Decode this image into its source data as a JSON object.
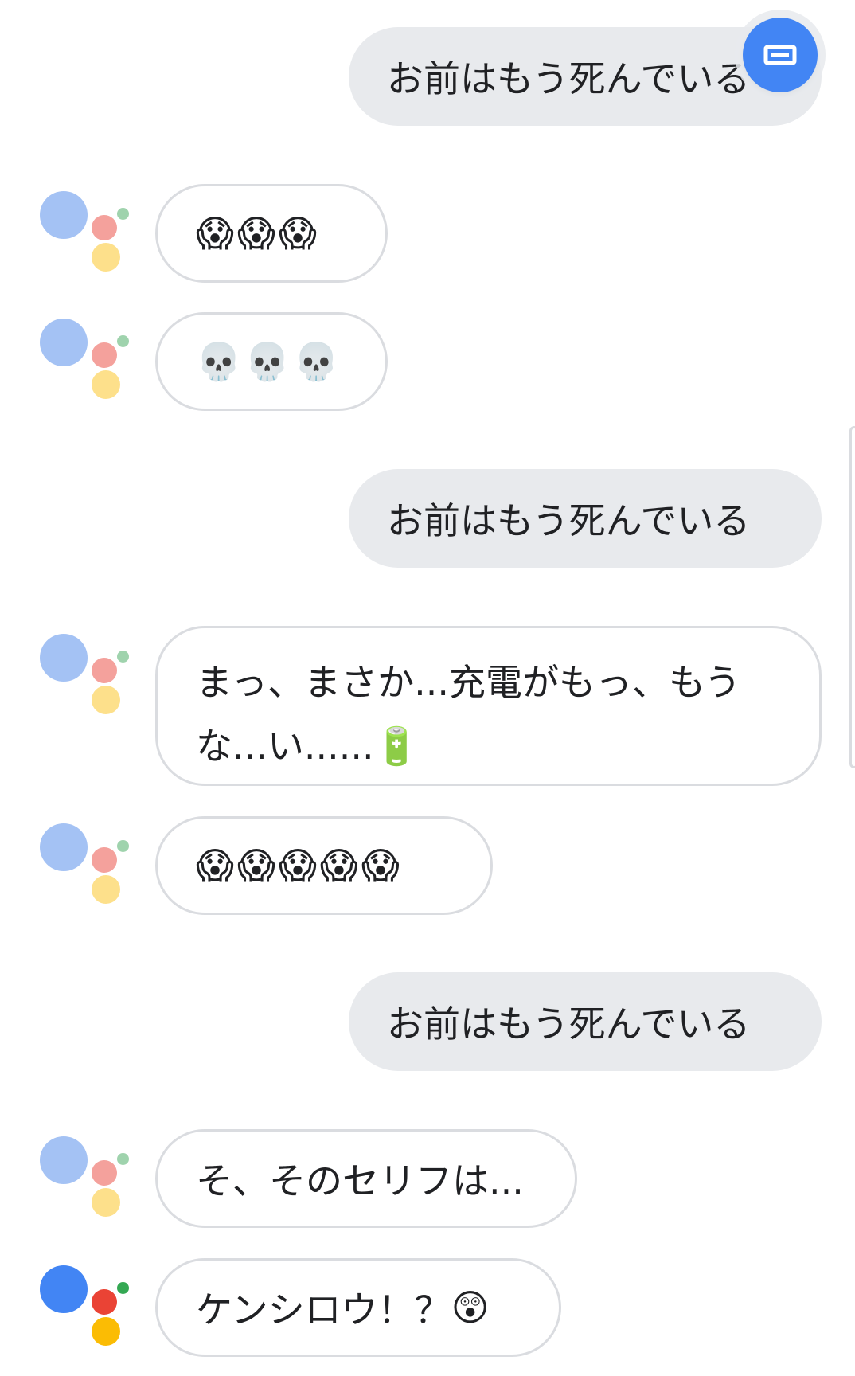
{
  "conversation": [
    {
      "role": "user",
      "text": "お前はもう死んでいる"
    },
    {
      "role": "assistant",
      "emojis": [
        "😱",
        "😱",
        "😱"
      ]
    },
    {
      "role": "assistant",
      "emojis": [
        "💀",
        "💀",
        "💀"
      ]
    },
    {
      "role": "user",
      "text": "お前はもう死んでいる"
    },
    {
      "role": "assistant",
      "line1": "まっ、まさか...充電がもっ、もう",
      "line2": "な...い......",
      "emoji": "🔋"
    },
    {
      "role": "assistant",
      "emojis": [
        "😱",
        "😱",
        "😱",
        "😱",
        "😱"
      ]
    },
    {
      "role": "user",
      "text": "お前はもう死んでいる"
    },
    {
      "role": "assistant",
      "text": "そ、そのセリフは..."
    },
    {
      "role": "assistant",
      "text": "ケンシロウ！？",
      "emoji": "😲"
    }
  ],
  "keyboard_button": {
    "icon": "keyboard-icon"
  },
  "colors": {
    "assistant_blue_faded": "#a4c2f4",
    "assistant_red_faded": "#f4a19c",
    "assistant_yellow_faded": "#fde08b",
    "assistant_green_faded": "#9fd3ad",
    "assistant_blue": "#4285f4",
    "assistant_red": "#ea4335",
    "assistant_yellow": "#fbbc04",
    "assistant_green": "#34a853",
    "user_bubble": "#e8eaed"
  }
}
